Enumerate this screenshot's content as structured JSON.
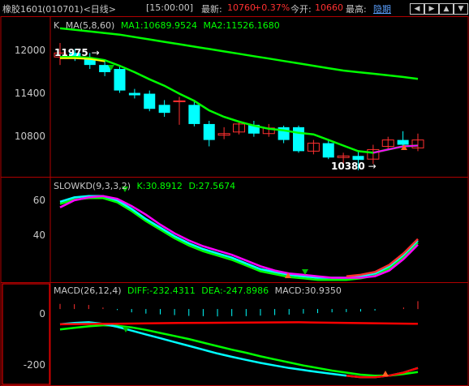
{
  "header": {
    "symbol": "橡胶1601",
    "code_period": "(010701)<日线>",
    "time": "[15:00:00]",
    "latest_label": "最新:",
    "latest_value": "10760",
    "change_pct": "+0.37%",
    "open_label": "今开:",
    "open_value": "10660",
    "high_label": "最高:",
    "high_link": "隐期"
  },
  "nav_buttons": [
    {
      "name": "prev-arrow-icon",
      "glyph": "◀"
    },
    {
      "name": "next-arrow-icon",
      "glyph": "▶"
    },
    {
      "name": "up-arrow-icon",
      "glyph": "▲"
    },
    {
      "name": "down-arrow-icon",
      "glyph": "▼"
    }
  ],
  "colors": {
    "up": "#ff3030",
    "down": "#00ffff",
    "ma5": "#ffffff",
    "ma8": "#ffff00",
    "ma60": "#00ff00",
    "k_line": "#00ffff",
    "d_line": "#ff00ff",
    "diff_line": "#ff0000",
    "dea_line": "#00ff00",
    "frame": "#b00000",
    "text_green": "#00ff00"
  },
  "kpanel": {
    "title": "K",
    "ma_label": "MA(5,8,60)",
    "ma1": "MA1:10689.9524",
    "ma2": "MA2:11526.1680",
    "max_label": "11975",
    "min_label": "10380",
    "yticks": [
      "12000",
      "11400",
      "10800"
    ]
  },
  "kdpanel": {
    "title": "SLOWKD(9,3,3,2)",
    "k": "K:30.8912",
    "d": "D:27.5674",
    "yticks": [
      "60",
      "40"
    ]
  },
  "macdpanel": {
    "title": "MACD(26,12,4)",
    "diff": "DIFF:-232.4311",
    "dea": "DEA:-247.8986",
    "macd": "MACD:30.9350",
    "yticks": [
      "0",
      "-200"
    ]
  },
  "chart_data": [
    {
      "type": "candlestick",
      "title": "K MA(5,8,60)",
      "ylim": [
        10380,
        12250
      ],
      "yticks": [
        12000,
        11400,
        10800
      ],
      "candles": [
        {
          "open": 11800,
          "close": 11850,
          "high": 11975,
          "low": 11700,
          "dir": "up"
        },
        {
          "open": 11850,
          "close": 11780,
          "high": 11900,
          "low": 11750,
          "dir": "down"
        },
        {
          "open": 11780,
          "close": 11700,
          "high": 11850,
          "low": 11650,
          "dir": "down"
        },
        {
          "open": 11700,
          "close": 11610,
          "high": 11760,
          "low": 11560,
          "dir": "down"
        },
        {
          "open": 11650,
          "close": 11380,
          "high": 11680,
          "low": 11350,
          "dir": "down"
        },
        {
          "open": 11350,
          "close": 11320,
          "high": 11400,
          "low": 11280,
          "dir": "down"
        },
        {
          "open": 11340,
          "close": 11150,
          "high": 11380,
          "low": 11120,
          "dir": "down"
        },
        {
          "open": 11200,
          "close": 11100,
          "high": 11260,
          "low": 11050,
          "dir": "down"
        },
        {
          "open": 11250,
          "close": 11250,
          "high": 11300,
          "low": 10950,
          "dir": "up"
        },
        {
          "open": 11200,
          "close": 10960,
          "high": 11260,
          "low": 10930,
          "dir": "down"
        },
        {
          "open": 10960,
          "close": 10760,
          "high": 11000,
          "low": 10680,
          "dir": "down"
        },
        {
          "open": 10820,
          "close": 10840,
          "high": 10920,
          "low": 10770,
          "dir": "up"
        },
        {
          "open": 10860,
          "close": 10960,
          "high": 10990,
          "low": 10830,
          "dir": "up"
        },
        {
          "open": 10950,
          "close": 10840,
          "high": 11000,
          "low": 10800,
          "dir": "down"
        },
        {
          "open": 10840,
          "close": 10910,
          "high": 10960,
          "low": 10800,
          "dir": "up"
        },
        {
          "open": 10920,
          "close": 10760,
          "high": 10940,
          "low": 10720,
          "dir": "down"
        },
        {
          "open": 10920,
          "close": 10620,
          "high": 10940,
          "low": 10600,
          "dir": "down"
        },
        {
          "open": 10620,
          "close": 10720,
          "high": 10760,
          "low": 10580,
          "dir": "up"
        },
        {
          "open": 10720,
          "close": 10540,
          "high": 10760,
          "low": 10520,
          "dir": "down"
        },
        {
          "open": 10540,
          "close": 10560,
          "high": 10600,
          "low": 10440,
          "dir": "up"
        },
        {
          "open": 10560,
          "close": 10510,
          "high": 10620,
          "low": 10380,
          "dir": "down"
        },
        {
          "open": 10520,
          "close": 10640,
          "high": 10700,
          "low": 10460,
          "dir": "up"
        },
        {
          "open": 10680,
          "close": 10760,
          "high": 10800,
          "low": 10640,
          "dir": "up"
        },
        {
          "open": 10760,
          "close": 10700,
          "high": 10870,
          "low": 10660,
          "dir": "down"
        },
        {
          "open": 10660,
          "close": 10760,
          "high": 10840,
          "low": 10620,
          "dir": "up"
        }
      ],
      "series": [
        {
          "name": "MA1",
          "values": [
            11800,
            11800,
            11790,
            11760,
            11690,
            11610,
            11520,
            11440,
            11340,
            11250,
            11130,
            11050,
            10990,
            10940,
            10900,
            10880,
            10850,
            10830,
            10760,
            10690,
            10620,
            10600,
            10640,
            10680,
            10690
          ]
        },
        {
          "name": "MA2",
          "values": [
            12160,
            12140,
            12120,
            12100,
            12080,
            12050,
            12020,
            11990,
            11960,
            11930,
            11900,
            11870,
            11840,
            11810,
            11780,
            11750,
            11720,
            11690,
            11660,
            11630,
            11610,
            11590,
            11570,
            11550,
            11526
          ]
        }
      ]
    },
    {
      "type": "line",
      "title": "SLOWKD(9,3,3,2)",
      "ylim": [
        3,
        72
      ],
      "yticks": [
        60,
        40
      ],
      "series": [
        {
          "name": "K",
          "values": [
            58,
            61,
            62,
            62,
            59,
            53,
            46,
            40,
            34,
            29,
            25,
            22,
            19,
            15,
            11,
            9,
            7,
            6,
            5,
            5,
            5,
            6,
            8,
            13,
            21,
            31
          ]
        },
        {
          "name": "D",
          "values": [
            54,
            59,
            61,
            62,
            60,
            55,
            49,
            42,
            36,
            31,
            27,
            24,
            21,
            17,
            13,
            10,
            8,
            7,
            6,
            5,
            5,
            5,
            6,
            10,
            18,
            28
          ]
        }
      ]
    },
    {
      "type": "line",
      "title": "MACD(26,12,4)",
      "ylim": [
        -290,
        80
      ],
      "yticks": [
        0,
        -200
      ],
      "series": [
        {
          "name": "DIFF",
          "values": [
            -60,
            -55,
            -52,
            -58,
            -70,
            -85,
            -100,
            -115,
            -130,
            -145,
            -160,
            -175,
            -188,
            -200,
            -212,
            -222,
            -232,
            -240,
            -248,
            -255,
            -262,
            -268,
            -268,
            -262,
            -250,
            -232
          ]
        },
        {
          "name": "DEA",
          "values": [
            -80,
            -74,
            -68,
            -64,
            -66,
            -72,
            -82,
            -94,
            -106,
            -118,
            -132,
            -146,
            -160,
            -172,
            -186,
            -198,
            -210,
            -222,
            -232,
            -242,
            -250,
            -258,
            -262,
            -262,
            -256,
            -248
          ]
        },
        {
          "name": "MACD",
          "values": [
            20,
            19,
            16,
            6,
            -4,
            -13,
            -18,
            -21,
            -24,
            -27,
            -28,
            -29,
            -28,
            -28,
            -26,
            -24,
            -22,
            -18,
            -16,
            -13,
            -12,
            -10,
            -6,
            0,
            6,
            31
          ]
        }
      ]
    }
  ]
}
